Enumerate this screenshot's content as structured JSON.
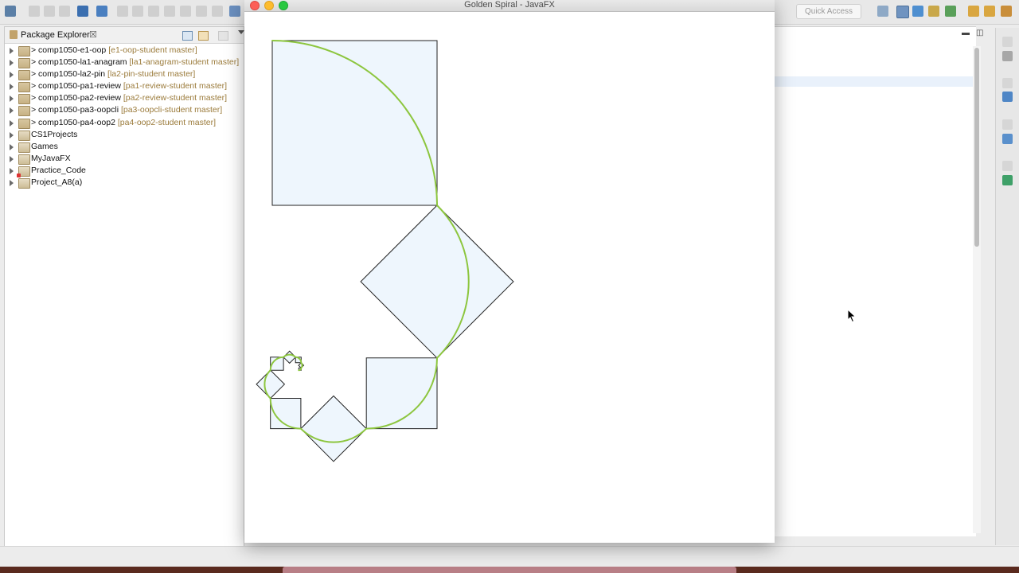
{
  "toolbar": {
    "quick_access_placeholder": "Quick Access"
  },
  "package_explorer": {
    "title": "Package Explorer",
    "close_glyph": "☒",
    "items": [
      {
        "prefix": "> ",
        "name": "comp1050-e1-oop",
        "branch": " [e1-oop-student master]",
        "icon": "git-project-icon"
      },
      {
        "prefix": "> ",
        "name": "comp1050-la1-anagram",
        "branch": " [la1-anagram-student master]",
        "icon": "git-project-icon"
      },
      {
        "prefix": "> ",
        "name": "comp1050-la2-pin",
        "branch": " [la2-pin-student master]",
        "icon": "git-project-icon"
      },
      {
        "prefix": "> ",
        "name": "comp1050-pa1-review",
        "branch": " [pa1-review-student master]",
        "icon": "git-project-icon"
      },
      {
        "prefix": "> ",
        "name": "comp1050-pa2-review",
        "branch": " [pa2-review-student master]",
        "icon": "git-project-icon"
      },
      {
        "prefix": "> ",
        "name": "comp1050-pa3-oopcli",
        "branch": " [pa3-oopcli-student master]",
        "icon": "git-project-icon"
      },
      {
        "prefix": "> ",
        "name": "comp1050-pa4-oop2",
        "branch": " [pa4-oop2-student master]",
        "icon": "git-project-icon"
      },
      {
        "prefix": "",
        "name": "CS1Projects",
        "branch": "",
        "icon": "java-project-icon"
      },
      {
        "prefix": "",
        "name": "Games",
        "branch": "",
        "icon": "java-project-icon"
      },
      {
        "prefix": "",
        "name": "MyJavaFX",
        "branch": "",
        "icon": "java-project-icon"
      },
      {
        "prefix": "",
        "name": "Practice_Code",
        "branch": "",
        "icon": "java-project-error-icon"
      },
      {
        "prefix": "",
        "name": "Project_A8(a)",
        "branch": "",
        "icon": "java-project-icon"
      }
    ]
  },
  "fx_window": {
    "title": "Golden Spiral - JavaFX"
  },
  "colors": {
    "square_fill": "#eef6fd",
    "square_stroke": "#222222",
    "spiral_stroke": "#8dc63f"
  }
}
